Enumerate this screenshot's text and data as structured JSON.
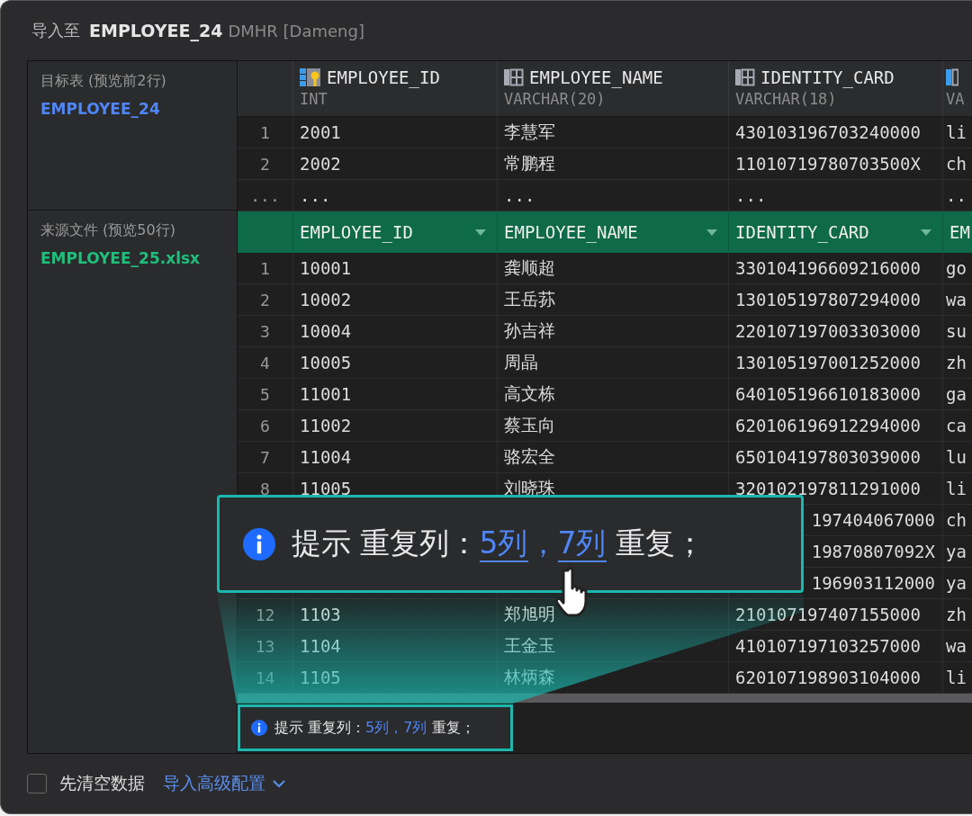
{
  "title": {
    "prefix": "导入至",
    "table": "EMPLOYEE_24",
    "schema": "DMHR [Dameng]"
  },
  "target": {
    "label": "目标表 (预览前2行)",
    "table_name": "EMPLOYEE_24",
    "columns": [
      {
        "kind": "key",
        "name": "EMPLOYEE_ID",
        "type": "INT"
      },
      {
        "kind": "plain",
        "name": "EMPLOYEE_NAME",
        "type": "VARCHAR(20)"
      },
      {
        "kind": "plain",
        "name": "IDENTITY_CARD",
        "type": "VARCHAR(18)"
      },
      {
        "kind": "marked",
        "type": "VA"
      }
    ],
    "rows": [
      {
        "number": "1",
        "cells": [
          "2001",
          "李慧军",
          "430103196703240000",
          "li"
        ]
      },
      {
        "number": "2",
        "cells": [
          "2002",
          "常鹏程",
          "11010719780703500X",
          "ch"
        ]
      },
      {
        "number": "...",
        "cells": [
          "...",
          "...",
          "...",
          ".."
        ]
      }
    ]
  },
  "source": {
    "label": "来源文件 (预览50行)",
    "file_name": "EMPLOYEE_25.xlsx",
    "columns": [
      {
        "name": "EMPLOYEE_ID",
        "dropdown": true
      },
      {
        "name": "EMPLOYEE_NAME",
        "dropdown": true
      },
      {
        "name": "IDENTITY_CARD",
        "dropdown": true
      },
      {
        "name": "EM"
      }
    ],
    "rows": [
      {
        "kind": "full",
        "number": "1",
        "cells": [
          "10001",
          "龚顺超",
          "330104196609216000",
          "go"
        ]
      },
      {
        "kind": "full",
        "number": "2",
        "cells": [
          "10002",
          "王岳荪",
          "130105197807294000",
          "wa"
        ]
      },
      {
        "kind": "full",
        "number": "3",
        "cells": [
          "10004",
          "孙吉祥",
          "220107197003303000",
          "su"
        ]
      },
      {
        "kind": "full",
        "number": "4",
        "cells": [
          "10005",
          "周晶",
          "130105197001252000",
          "zh"
        ]
      },
      {
        "kind": "full",
        "number": "5",
        "cells": [
          "11001",
          "高文栋",
          "640105196610183000",
          "ga"
        ]
      },
      {
        "kind": "full",
        "number": "6",
        "cells": [
          "11002",
          "蔡玉向",
          "620106196912294000",
          "ca"
        ]
      },
      {
        "kind": "full",
        "number": "7",
        "cells": [
          "11004",
          "骆宏全",
          "650104197803039000",
          "lu"
        ]
      },
      {
        "kind": "full",
        "number": "8",
        "cells": [
          "11005",
          "刘晓珠",
          "320102197811291000",
          "li"
        ]
      },
      {
        "kind": "covered",
        "cells": [
          "197404067000",
          "ch"
        ]
      },
      {
        "kind": "covered",
        "cells": [
          "19870807092X",
          "ya"
        ]
      },
      {
        "kind": "covered",
        "cells": [
          "196903112000",
          "ya"
        ]
      },
      {
        "kind": "full",
        "number": "12",
        "cells": [
          "1103",
          "郑旭明",
          "210107197407155000",
          "zh"
        ]
      },
      {
        "kind": "full",
        "number": "13",
        "cells": [
          "1104",
          "王金玉",
          "410107197103257000",
          "wa"
        ]
      },
      {
        "kind": "full",
        "number": "14",
        "cells": [
          "1105",
          "林炳森",
          "620107198903104000",
          "li"
        ]
      }
    ]
  },
  "hint_callout": {
    "links_underlined": true,
    "parts": [
      {
        "kind": "text",
        "text": "提示 重复列："
      },
      {
        "kind": "link",
        "text": "5列"
      },
      {
        "kind": "accent",
        "text": "，"
      },
      {
        "kind": "link",
        "text": "7列"
      },
      {
        "kind": "text",
        "text": " 重复；"
      }
    ]
  },
  "hint_box": {
    "links_underlined": false,
    "parts": [
      {
        "kind": "text",
        "text": "提示 重复列："
      },
      {
        "kind": "link",
        "text": "5列"
      },
      {
        "kind": "accent",
        "text": "，"
      },
      {
        "kind": "link",
        "text": "7列"
      },
      {
        "kind": "text",
        "text": " 重复；"
      }
    ]
  },
  "footer": {
    "checkbox": {
      "label": "先清空数据",
      "checked": false
    },
    "advanced": {
      "label": "导入高级配置",
      "expanded": false
    }
  }
}
